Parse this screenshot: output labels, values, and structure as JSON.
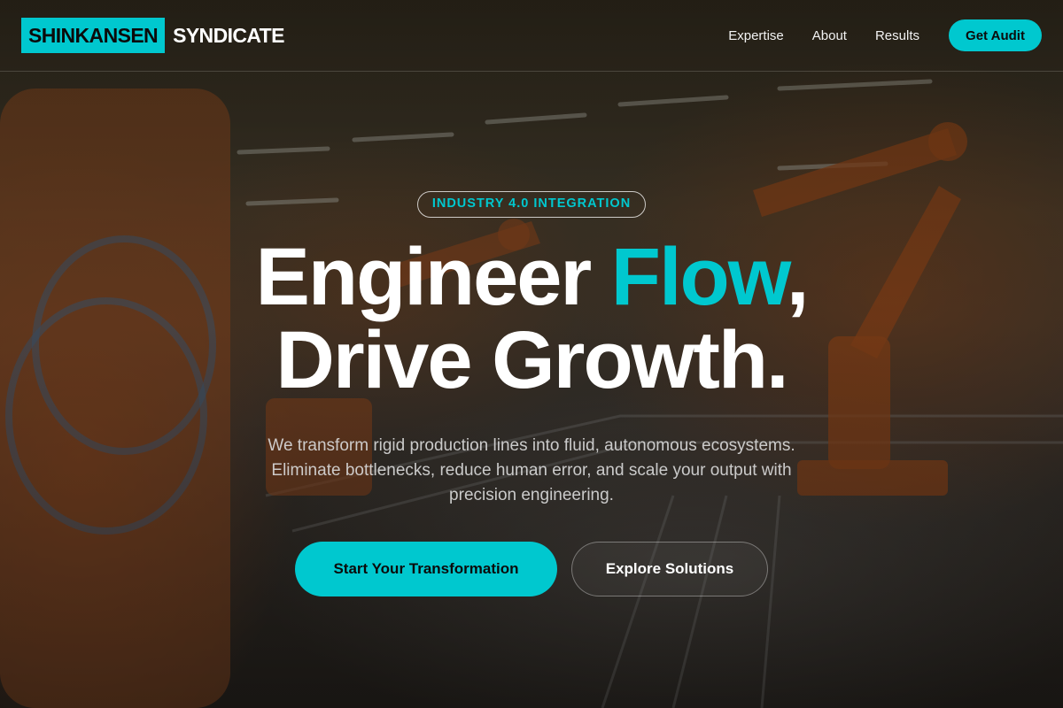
{
  "nav": {
    "logo_box": "SHINKANSEN",
    "logo_text": "SYNDICATE",
    "links": [
      {
        "label": "Expertise"
      },
      {
        "label": "About"
      },
      {
        "label": "Results"
      }
    ],
    "cta_label": "Get Audit"
  },
  "hero": {
    "badge": "INDUSTRY 4.0 INTEGRATION",
    "headline_part1": "Engineer ",
    "headline_accent": "Flow",
    "headline_part2": ",",
    "headline_line2": "Drive Growth.",
    "subtitle": "We transform rigid production lines into fluid, autonomous ecosystems. Eliminate bottlenecks, reduce human error, and scale your output with precision engineering.",
    "primary_button": "Start Your Transformation",
    "secondary_button": "Explore Solutions"
  },
  "colors": {
    "accent": "#00c8cf",
    "text": "#ffffff",
    "background_image": "factory-robot-arms"
  }
}
